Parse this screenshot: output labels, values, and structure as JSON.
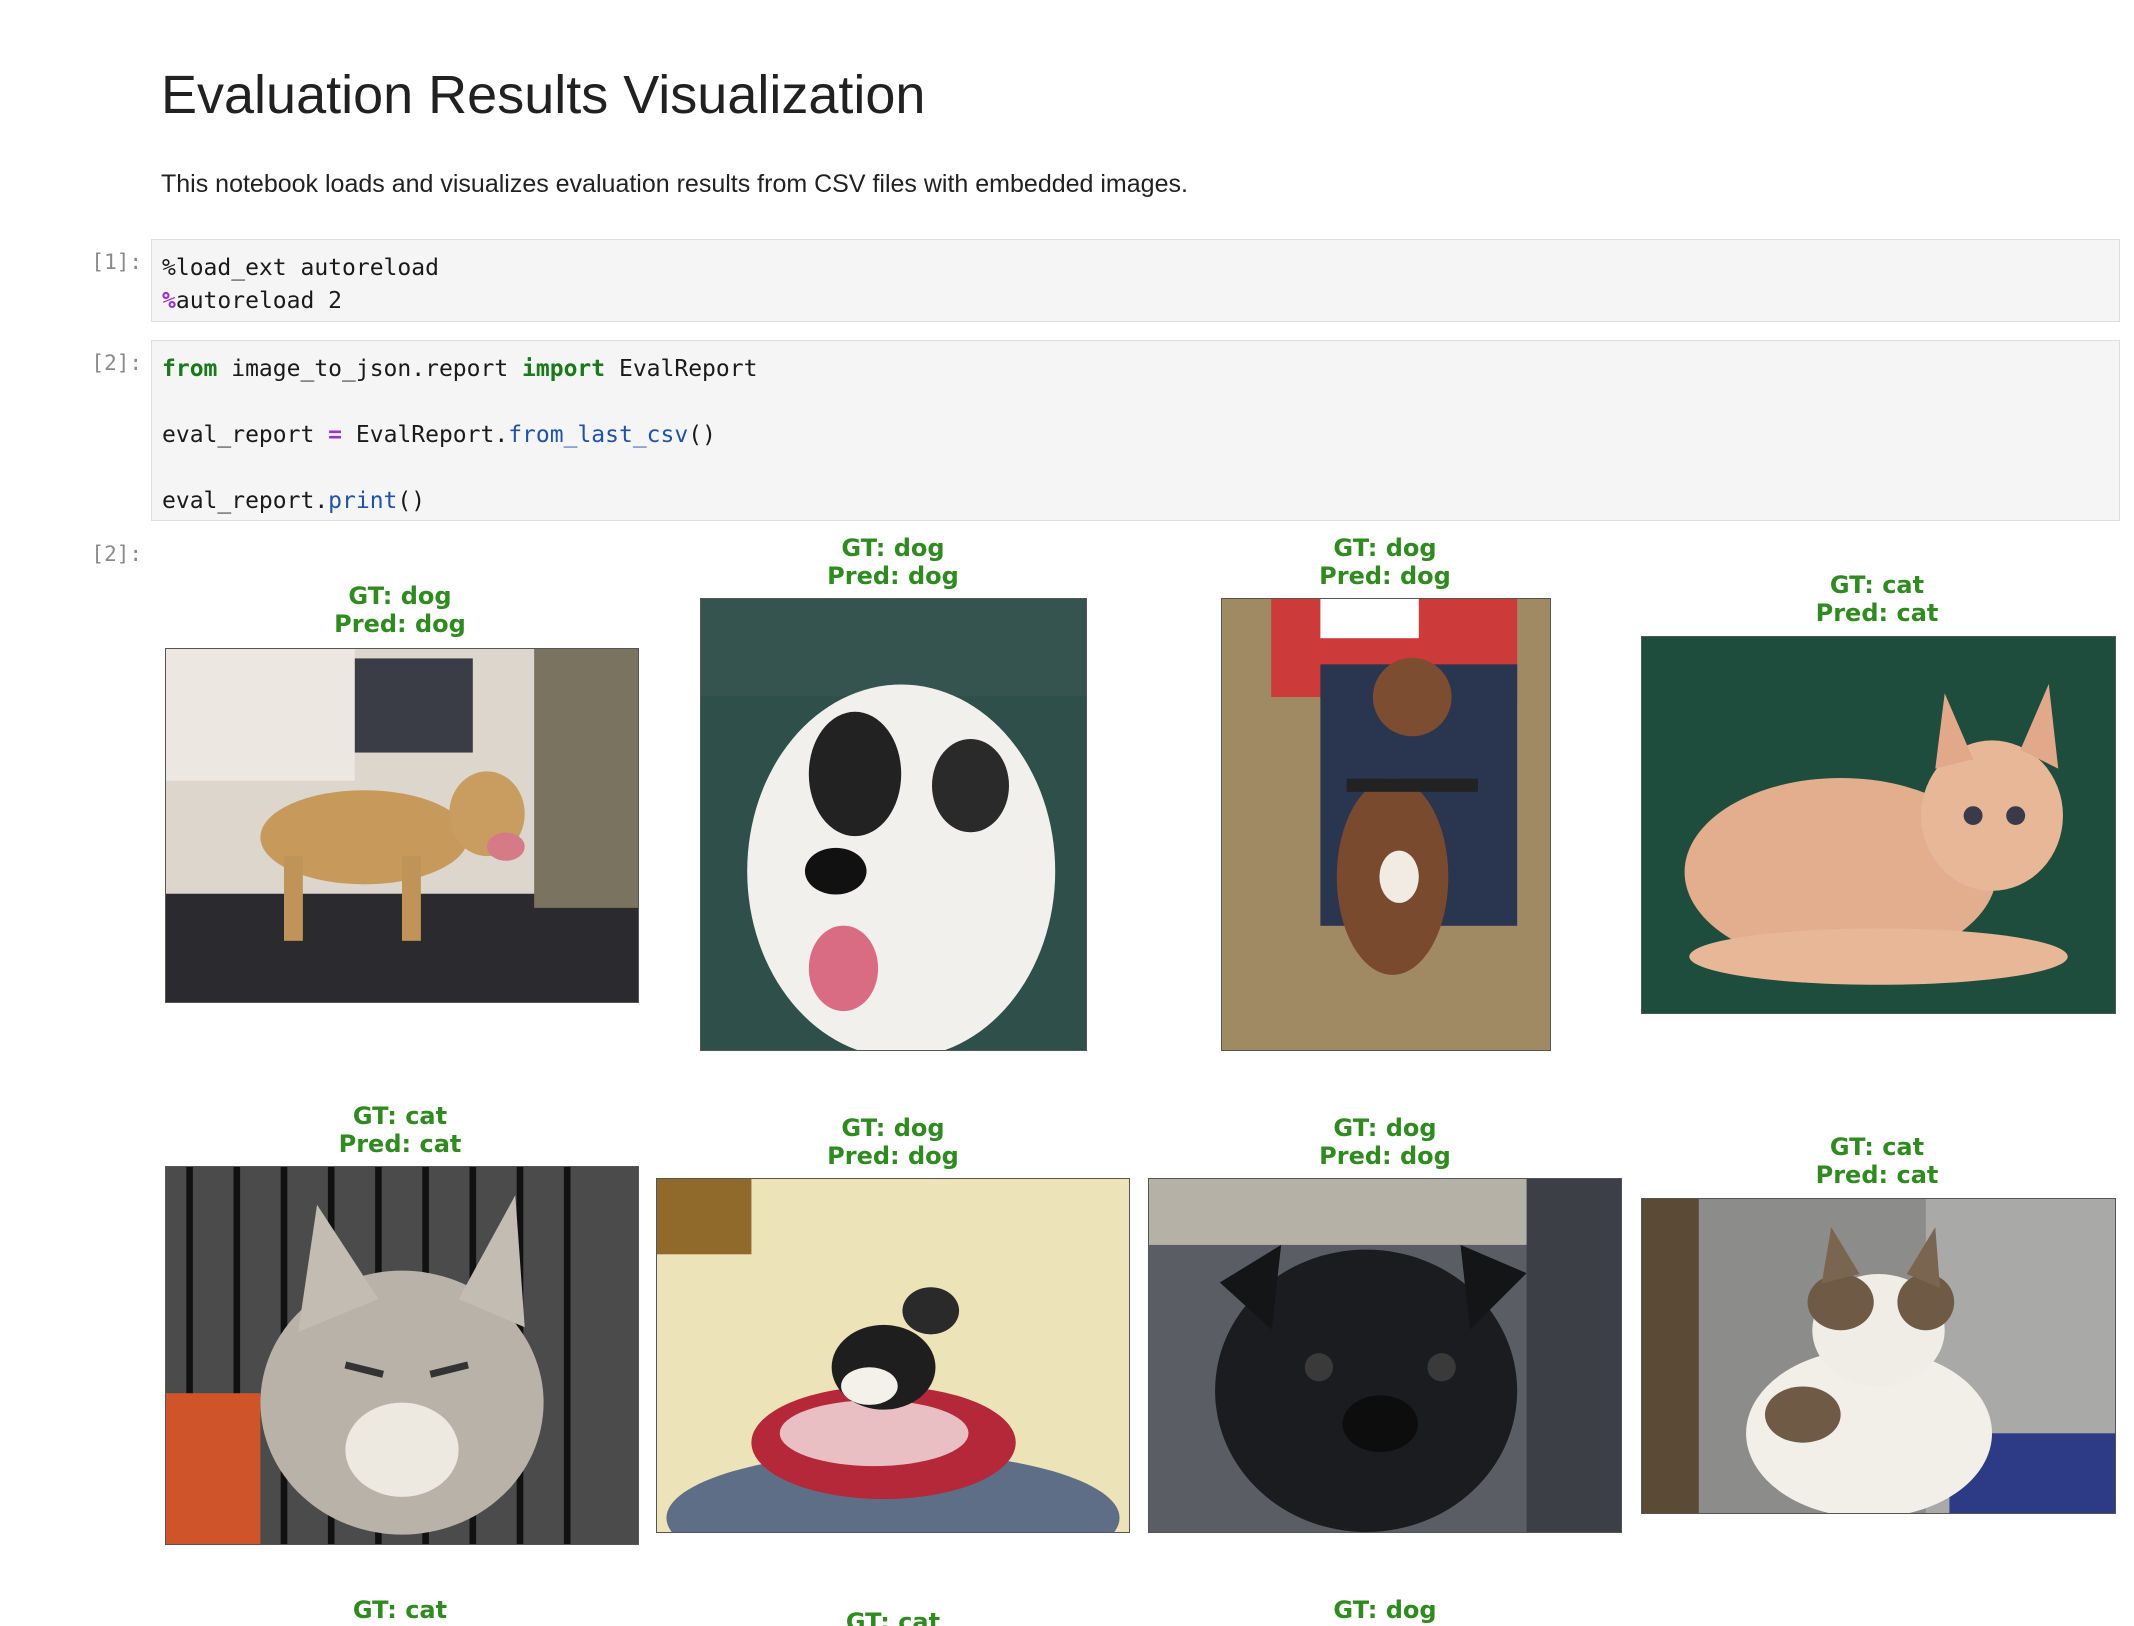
{
  "notebook": {
    "title": "Evaluation Results Visualization",
    "description": "This notebook loads and visualizes evaluation results from CSV files with embedded images."
  },
  "cells": [
    {
      "prompt": "[1]:",
      "lines": [
        [
          {
            "t": "%load_ext autoreload",
            "c": ""
          }
        ],
        [
          {
            "t": "%",
            "c": "op"
          },
          {
            "t": "autoreload 2",
            "c": ""
          }
        ]
      ]
    },
    {
      "prompt": "[2]:",
      "lines": [
        [
          {
            "t": "from",
            "c": "kw"
          },
          {
            "t": " image_to_json.report ",
            "c": ""
          },
          {
            "t": "import",
            "c": "kw"
          },
          {
            "t": " EvalReport",
            "c": ""
          }
        ],
        [],
        [
          {
            "t": "eval_report ",
            "c": ""
          },
          {
            "t": "=",
            "c": "op"
          },
          {
            "t": " EvalReport.",
            "c": ""
          },
          {
            "t": "from_last_csv",
            "c": "fn"
          },
          {
            "t": "()",
            "c": ""
          }
        ],
        [],
        [
          {
            "t": "eval_report.",
            "c": ""
          },
          {
            "t": "print",
            "c": "fn"
          },
          {
            "t": "()",
            "c": ""
          }
        ]
      ]
    }
  ],
  "output": {
    "prompt": "[2]:",
    "results": [
      {
        "gt": "GT: dog",
        "pred": "Pred: dog",
        "subject": "dog-tan"
      },
      {
        "gt": "GT: dog",
        "pred": "Pred: dog",
        "subject": "dog-white-shaggy"
      },
      {
        "gt": "GT: dog",
        "pred": "Pred: dog",
        "subject": "dog-brown-leash"
      },
      {
        "gt": "GT: cat",
        "pred": "Pred: cat",
        "subject": "cat-orange-kitten"
      },
      {
        "gt": "GT: cat",
        "pred": "Pred: cat",
        "subject": "cat-tabby-cage"
      },
      {
        "gt": "GT: dog",
        "pred": "Pred: dog",
        "subject": "dog-terrier-blanket"
      },
      {
        "gt": "GT: dog",
        "pred": "Pred: dog",
        "subject": "dog-black-pug"
      },
      {
        "gt": "GT: cat",
        "pred": "Pred: cat",
        "subject": "cat-white-tabby"
      },
      {
        "gt": "GT: cat",
        "pred": "",
        "subject": ""
      },
      {
        "gt": "GT: cat",
        "pred": "",
        "subject": ""
      },
      {
        "gt": "GT: dog",
        "pred": "",
        "subject": ""
      }
    ]
  },
  "colors": {
    "correct_label": "#2f8a1f",
    "keyword": "#1a7a1a",
    "operator": "#9b2fd0",
    "function": "#1f52a8"
  }
}
